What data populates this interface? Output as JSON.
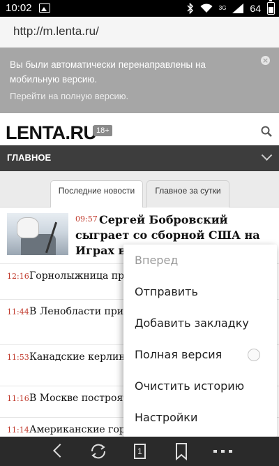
{
  "status_bar": {
    "time": "10:02",
    "network": "3G",
    "battery": "64"
  },
  "browser": {
    "url": "http://m.lenta.ru/"
  },
  "notice": {
    "message": "Вы были автоматически перенаправлены на мобильную версию.",
    "link": "Перейти на полную версию.",
    "close_label": "×"
  },
  "site": {
    "logo": "LENTA.RU",
    "age_badge": "18+"
  },
  "nav": {
    "label": "ГЛАВНОЕ"
  },
  "tabs": [
    {
      "label": "Последние новости"
    },
    {
      "label": "Главное за сутки"
    }
  ],
  "featured": {
    "time": "09:57",
    "title": "Сергей Бобровский сыграет со сборной США на Играх в Сочи"
  },
  "news": [
    {
      "time": "12:16",
      "title": "Горнолыжница при Игр-2014"
    },
    {
      "time": "11:44",
      "title": "В Ленобласти при а погибли девять человек"
    },
    {
      "time": "11:53",
      "title": "Канадские керлинг Олимпиады подряд"
    },
    {
      "time": "11:16",
      "title": "В Москве построят"
    },
    {
      "time": "11:14",
      "title": "Американские горнолыжники"
    }
  ],
  "menu": {
    "items": [
      {
        "label": "Вперед",
        "disabled": true
      },
      {
        "label": "Отправить"
      },
      {
        "label": "Добавить закладку"
      },
      {
        "label": "Полная версия",
        "toggle": false
      },
      {
        "label": "Очистить историю"
      },
      {
        "label": "Настройки"
      }
    ]
  },
  "toolbar": {
    "tab_count": "1"
  }
}
